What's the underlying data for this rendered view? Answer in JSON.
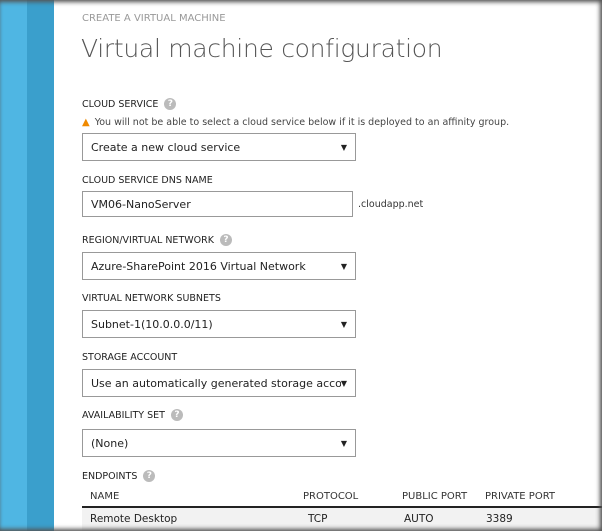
{
  "header": {
    "subtitle": "CREATE A VIRTUAL MACHINE",
    "title": "Virtual machine configuration"
  },
  "cloud_service": {
    "label": "CLOUD SERVICE",
    "warning": "You will not be able to select a cloud service below if it is deployed to an affinity group.",
    "value": "Create a new cloud service"
  },
  "dns": {
    "label": "CLOUD SERVICE DNS NAME",
    "value": "VM06-NanoServer",
    "suffix": ".cloudapp.net"
  },
  "region": {
    "label": "REGION/VIRTUAL NETWORK",
    "value": "Azure-SharePoint 2016 Virtual Network"
  },
  "subnets": {
    "label": "VIRTUAL NETWORK SUBNETS",
    "value": "Subnet-1(10.0.0.0/11)"
  },
  "storage": {
    "label": "STORAGE ACCOUNT",
    "value": "Use an automatically generated storage accoun"
  },
  "availability": {
    "label": "AVAILABILITY SET",
    "value": "(None)"
  },
  "endpoints": {
    "label": "ENDPOINTS",
    "columns": [
      "NAME",
      "PROTOCOL",
      "PUBLIC PORT",
      "PRIVATE PORT"
    ],
    "rows": [
      [
        "Remote Desktop",
        "TCP",
        "AUTO",
        "3389"
      ]
    ]
  },
  "icons": {
    "help": "?",
    "warning": "▲",
    "arrow": "▼"
  }
}
